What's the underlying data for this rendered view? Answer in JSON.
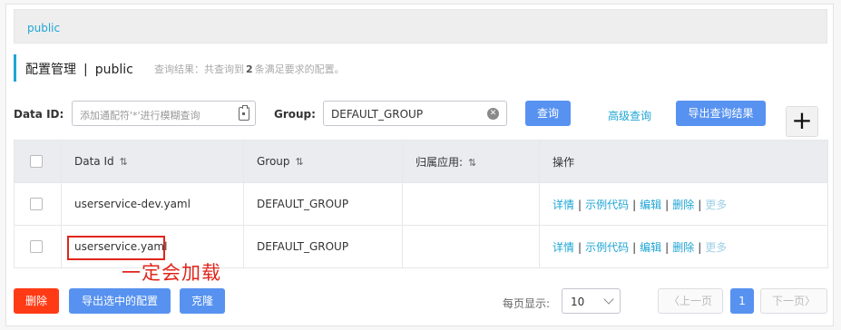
{
  "namespace": {
    "active": "public"
  },
  "title": {
    "main": "配置管理",
    "separator": "|",
    "namespace": "public"
  },
  "result": {
    "prefix": "查询结果：共查询到",
    "count": "2",
    "suffix": "条满足要求的配置。"
  },
  "search": {
    "data_id_label": "Data ID:",
    "data_id_placeholder": "添加通配符'*'进行模糊查询",
    "group_label": "Group:",
    "group_value": "DEFAULT_GROUP",
    "query_button": "查询",
    "advanced_link": "高级查询",
    "export_results_button": "导出查询结果",
    "add_button": "+"
  },
  "table": {
    "columns": [
      "Data Id",
      "Group",
      "归属应用:",
      "操作"
    ],
    "rows": [
      {
        "data_id": "userservice-dev.yaml",
        "group": "DEFAULT_GROUP",
        "app": ""
      },
      {
        "data_id": "userservice.yaml",
        "group": "DEFAULT_GROUP",
        "app": ""
      }
    ],
    "actions": [
      "详情",
      "示例代码",
      "编辑",
      "删除",
      "更多"
    ]
  },
  "annotation": {
    "text": "一定会加载",
    "color": "#e0251b"
  },
  "footer": {
    "delete_button": "删除",
    "export_selected_button": "导出选中的配置",
    "clone_button": "克隆",
    "page_size_label": "每页显示:",
    "page_size_value": "10",
    "prev_button": "上一页",
    "current_page": "1",
    "next_button": "下一页"
  },
  "colors": {
    "accent": "#1fa5d4",
    "primary": "#5792f0",
    "danger": "#ff3b16"
  }
}
